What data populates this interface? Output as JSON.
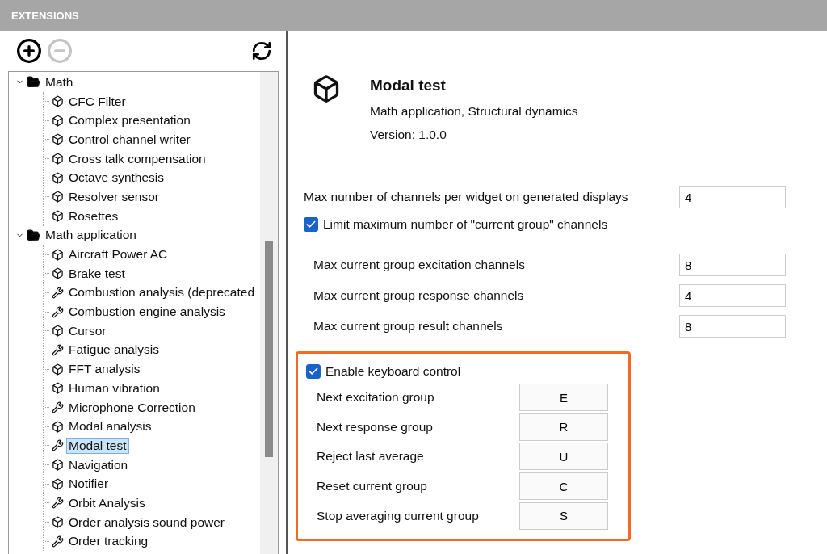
{
  "header": {
    "title": "EXTENSIONS"
  },
  "toolbar": [
    {
      "kind": "add",
      "disabled": false
    },
    {
      "kind": "remove",
      "disabled": true
    },
    {
      "kind": "refresh",
      "disabled": false
    }
  ],
  "tree": [
    {
      "label": "Math",
      "expanded": true,
      "children": [
        {
          "label": "CFC Filter",
          "kind": "block",
          "selected": false
        },
        {
          "label": "Complex presentation",
          "kind": "block",
          "selected": false
        },
        {
          "label": "Control channel writer",
          "kind": "block",
          "selected": false
        },
        {
          "label": "Cross talk compensation",
          "kind": "block",
          "selected": false
        },
        {
          "label": "Octave synthesis",
          "kind": "block",
          "selected": false
        },
        {
          "label": "Resolver sensor",
          "kind": "block",
          "selected": false
        },
        {
          "label": "Rosettes",
          "kind": "block",
          "selected": false
        }
      ]
    },
    {
      "label": "Math application",
      "expanded": true,
      "children": [
        {
          "label": "Aircraft Power AC",
          "kind": "block",
          "selected": false
        },
        {
          "label": "Brake test",
          "kind": "block",
          "selected": false
        },
        {
          "label": "Combustion analysis (deprecated",
          "kind": "tool",
          "selected": false
        },
        {
          "label": "Combustion engine analysis",
          "kind": "tool",
          "selected": false
        },
        {
          "label": "Cursor",
          "kind": "block",
          "selected": false
        },
        {
          "label": "Fatigue analysis",
          "kind": "tool",
          "selected": false
        },
        {
          "label": "FFT analysis",
          "kind": "block",
          "selected": false
        },
        {
          "label": "Human vibration",
          "kind": "block",
          "selected": false
        },
        {
          "label": "Microphone Correction",
          "kind": "tool",
          "selected": false
        },
        {
          "label": "Modal analysis",
          "kind": "block",
          "selected": false
        },
        {
          "label": "Modal test",
          "kind": "tool",
          "selected": true
        },
        {
          "label": "Navigation",
          "kind": "block",
          "selected": false
        },
        {
          "label": "Notifier",
          "kind": "block",
          "selected": false
        },
        {
          "label": "Orbit Analysis",
          "kind": "tool",
          "selected": false
        },
        {
          "label": "Order analysis sound power",
          "kind": "block",
          "selected": false
        },
        {
          "label": "Order tracking",
          "kind": "tool",
          "selected": false
        }
      ]
    }
  ],
  "details": {
    "name": "Modal test",
    "category": "Math application, Structural dynamics",
    "version": "Version: 1.0.0"
  },
  "max_channels": {
    "label": "Max number of channels per widget on generated displays",
    "value": "4"
  },
  "limit_group": {
    "label": "Limit maximum number of \"current group\" channels",
    "checked": true
  },
  "group_limits": [
    {
      "label": "Max current group excitation channels",
      "value": "8"
    },
    {
      "label": "Max current group response channels",
      "value": "4"
    },
    {
      "label": "Max current group result channels",
      "value": "8"
    }
  ],
  "keyboard": {
    "label": "Enable keyboard control",
    "checked": true,
    "highlighted": true,
    "keys": [
      {
        "label": "Next excitation group",
        "key": "E"
      },
      {
        "label": "Next response group",
        "key": "R"
      },
      {
        "label": "Reject last average",
        "key": "U"
      },
      {
        "label": "Reset current group",
        "key": "C"
      },
      {
        "label": "Stop averaging current group",
        "key": "S"
      }
    ]
  }
}
